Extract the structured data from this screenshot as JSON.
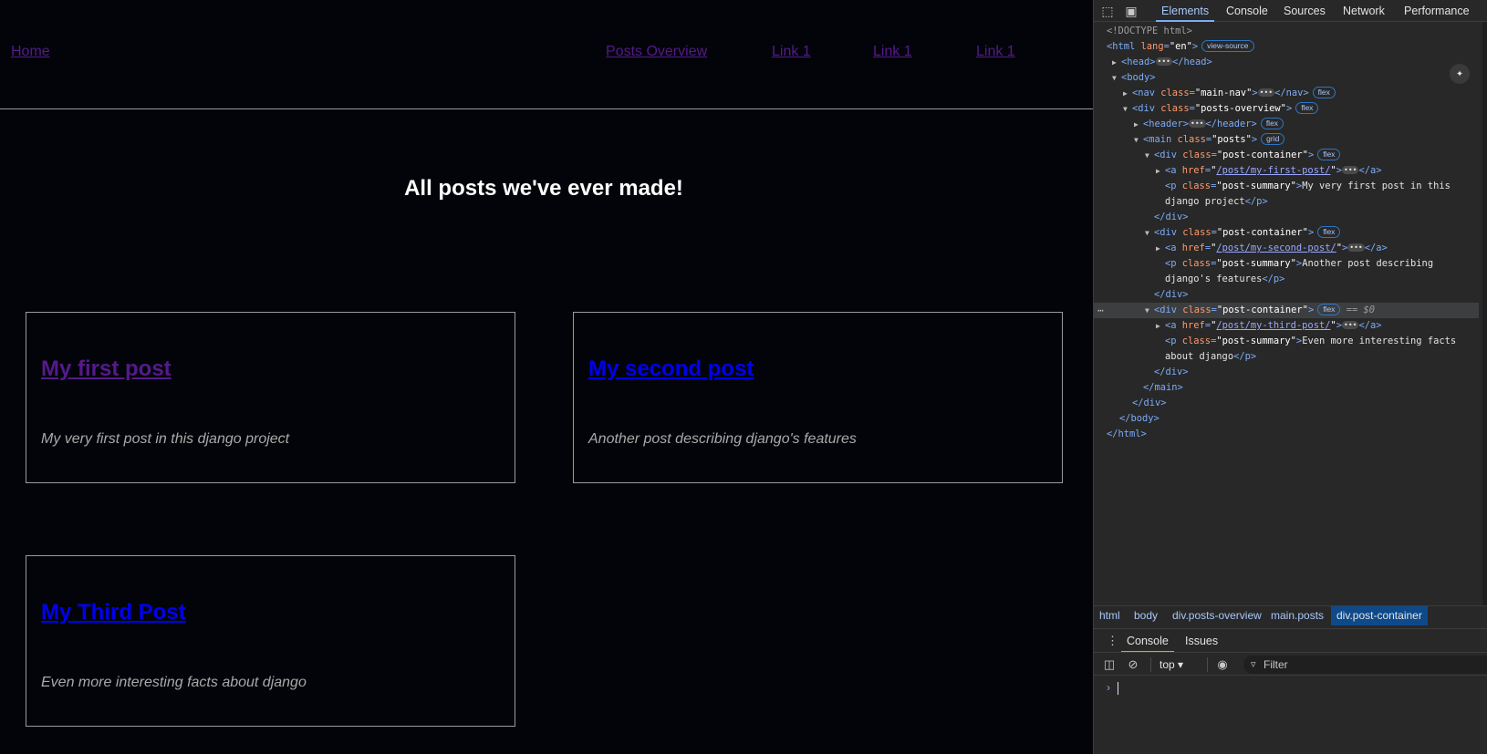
{
  "page": {
    "nav": {
      "home": "Home",
      "posts_overview": "Posts Overview",
      "link1": "Link 1",
      "link2": "Link 1",
      "link3": "Link 1"
    },
    "heading": "All posts we've ever made!",
    "posts": [
      {
        "title": "My first post",
        "summary": "My very first post in this django project",
        "visited": true
      },
      {
        "title": "My second post",
        "summary": "Another post describing django's features",
        "visited": false
      },
      {
        "title": "My Third Post",
        "summary": "Even more interesting facts about django",
        "visited": false
      }
    ]
  },
  "devtools": {
    "tabs": [
      "Elements",
      "Console",
      "Sources",
      "Network",
      "Performance"
    ],
    "active_tab": "Elements",
    "dom": {
      "doctype": "<!DOCTYPE html>",
      "html_open": "<html",
      "lang_attr": "lang",
      "lang_val": "\"en\"",
      "view_source": "view-source",
      "head": "<head>",
      "head_close": "</head>",
      "body": "<body>",
      "nav_tag": "<nav",
      "class_attr": "class",
      "nav_class": "\"main-nav\"",
      "nav_close": "</nav>",
      "div_tag": "<div",
      "overview_class": "\"posts-overview\"",
      "header": "<header>",
      "header_close": "</header>",
      "main_tag": "<main",
      "main_class": "\"posts\"",
      "container_class": "\"post-container\"",
      "a_tag": "<a",
      "href_attr": "href",
      "href1": "/post/my-first-post/",
      "href2": "/post/my-second-post/",
      "href3": "/post/my-third-post/",
      "a_close": "</a>",
      "p_tag": "<p",
      "summary_class": "\"post-summary\"",
      "p1_text_a": "My very first post in this",
      "p1_text_b": "django project",
      "p2_text_a": "Another post describing",
      "p2_text_b": "django's features",
      "p3_text_a": "Even more interesting facts",
      "p3_text_b": "about django",
      "p_close": "</p>",
      "div_close": "</div>",
      "main_close": "</main>",
      "body_close": "</body>",
      "html_close": "</html>",
      "badge_flex": "flex",
      "badge_grid": "grid",
      "selected_marker": "== $0"
    },
    "breadcrumbs": [
      "html",
      "body",
      "div.posts-overview",
      "main.posts",
      "div.post-container"
    ],
    "drawer_tabs": [
      "Console",
      "Issues"
    ],
    "console": {
      "context": "top",
      "filter_placeholder": "Filter"
    }
  }
}
